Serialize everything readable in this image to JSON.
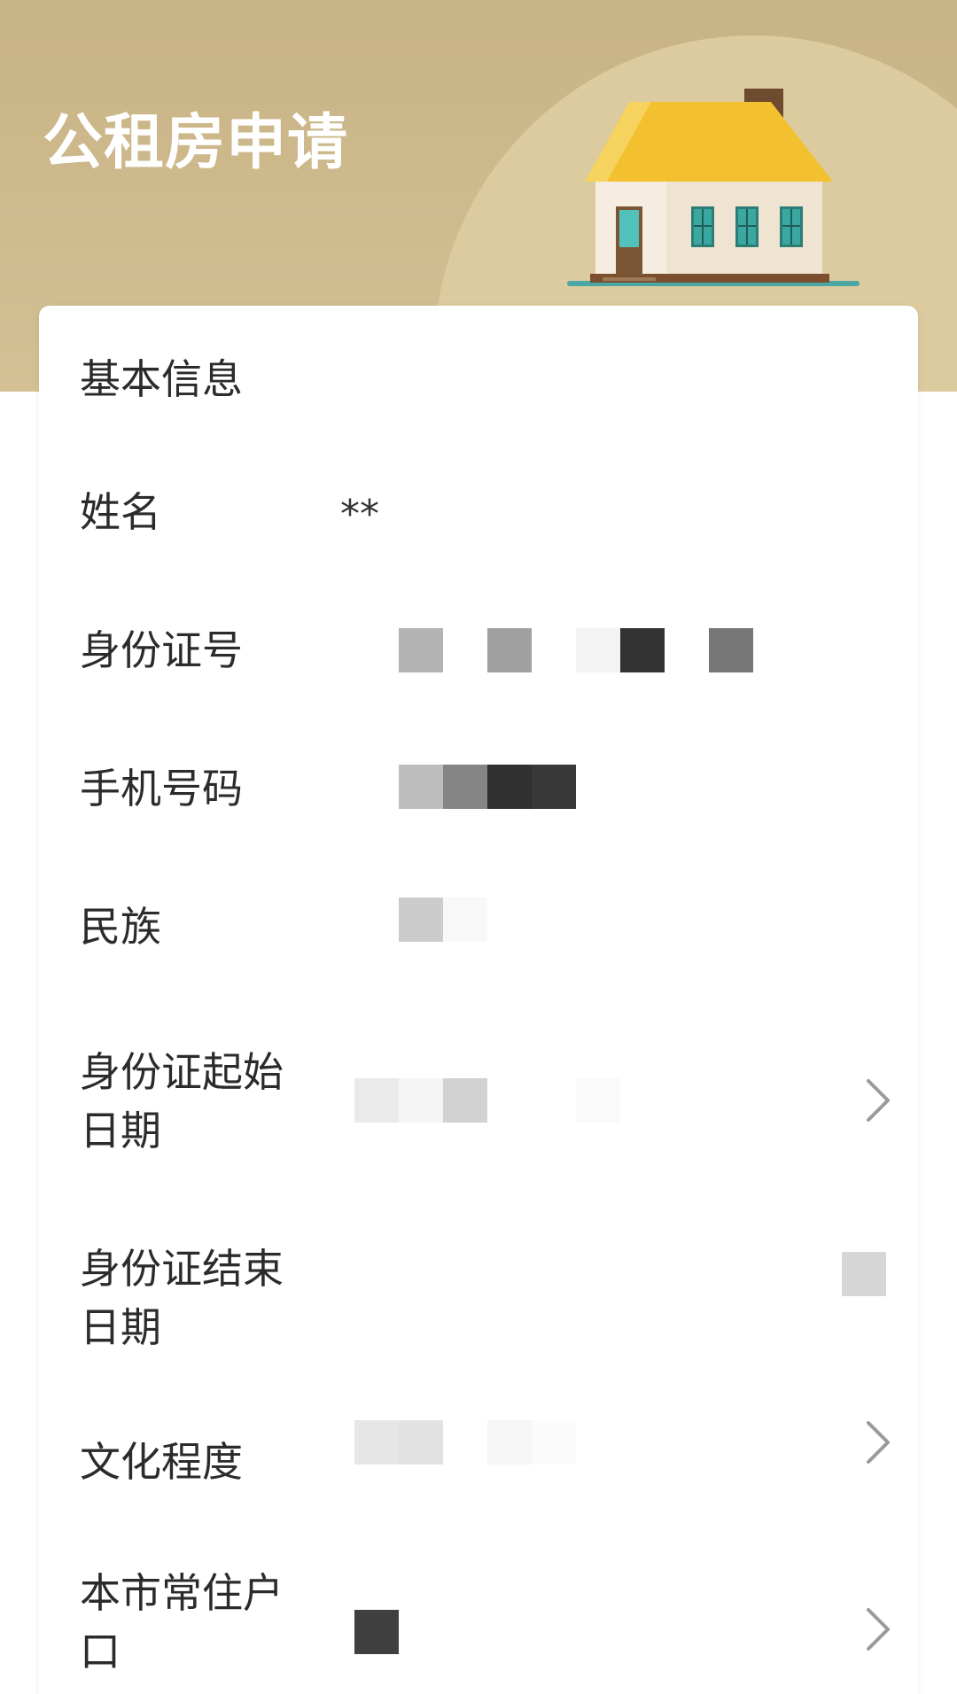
{
  "header": {
    "title": "公租房申请"
  },
  "form": {
    "section_title": "基本信息",
    "rows": [
      {
        "label": "姓名",
        "value": "**"
      },
      {
        "label": "身份证号",
        "value": ""
      },
      {
        "label": "手机号码",
        "value": ""
      },
      {
        "label": "民族",
        "value": ""
      },
      {
        "label": "身份证起始日期",
        "value": ""
      },
      {
        "label": "身份证结束日期",
        "value": ""
      },
      {
        "label": "文化程度",
        "value": ""
      },
      {
        "label": "本市常住户口",
        "value": ""
      }
    ]
  },
  "icons": {
    "house": "house-illustration-icon",
    "chevron": "chevron-right-icon"
  },
  "colors": {
    "header_bg": "#c8b386",
    "roof": "#f3c12f",
    "chimney": "#6e4a2e",
    "window": "#3aa8a1"
  }
}
